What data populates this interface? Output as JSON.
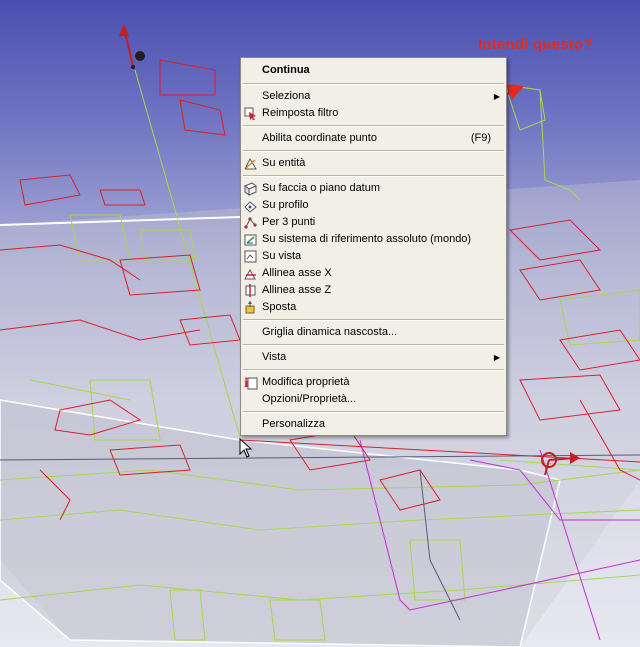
{
  "annotation": {
    "text": "Intendi questo?"
  },
  "menu": {
    "items": [
      {
        "label": "Continua",
        "bold": true
      },
      {
        "sep": true
      },
      {
        "label": "Seleziona",
        "submenu": true
      },
      {
        "label": "Reimposta filtro",
        "icon": "filter-reset-icon"
      },
      {
        "sep": true
      },
      {
        "label": "Abilita coordinate punto",
        "shortcut": "(F9)"
      },
      {
        "sep": true
      },
      {
        "label": "Su entità",
        "icon": "on-entity-icon"
      },
      {
        "sep": true
      },
      {
        "label": "Su faccia o piano datum",
        "icon": "face-datum-plane-icon"
      },
      {
        "label": "Su profilo",
        "icon": "on-profile-icon"
      },
      {
        "label": "Per 3 punti",
        "icon": "three-points-icon"
      },
      {
        "label": "Su sistema di riferimento assoluto (mondo)",
        "icon": "world-reference-icon"
      },
      {
        "label": "Su vista",
        "icon": "on-view-icon"
      },
      {
        "label": "Allinea asse X",
        "icon": "align-x-axis-icon"
      },
      {
        "label": "Allinea asse Z",
        "icon": "align-z-axis-icon"
      },
      {
        "label": "Sposta",
        "icon": "move-icon"
      },
      {
        "sep": true
      },
      {
        "label": "Griglia dinamica nascosta..."
      },
      {
        "sep": true
      },
      {
        "label": "Vista",
        "submenu": true
      },
      {
        "sep": true
      },
      {
        "label": "Modifica proprietà",
        "icon": "edit-properties-icon"
      },
      {
        "label": "Opzioni/Proprietà..."
      },
      {
        "sep": true
      },
      {
        "label": "Personalizza"
      }
    ]
  },
  "colors": {
    "accent": "#e42a1f",
    "menu_bg": "#f1efe6",
    "wire_red": "#d8202a",
    "wire_green": "#a6d84a",
    "wire_magenta": "#c030d0"
  }
}
